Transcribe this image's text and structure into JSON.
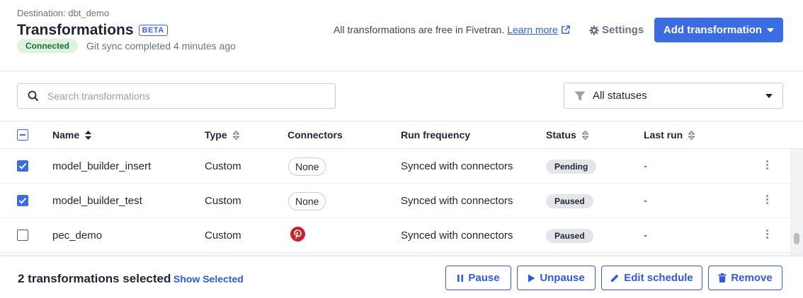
{
  "header": {
    "destination": "Destination: dbt_demo",
    "title": "Transformations",
    "beta": "BETA",
    "connected": "Connected",
    "git_sync": "Git sync completed 4 minutes ago",
    "free_note": "All transformations are free in Fivetran.",
    "learn_more": "Learn more",
    "settings": "Settings",
    "add_button": "Add transformation"
  },
  "filters": {
    "search_placeholder": "Search transformations",
    "status_selected": "All statuses"
  },
  "table": {
    "columns": [
      "Name",
      "Type",
      "Connectors",
      "Run frequency",
      "Status",
      "Last run"
    ],
    "rows": [
      {
        "name": "model_builder_insert",
        "type": "Custom",
        "connector": "None",
        "frequency": "Synced with connectors",
        "status": "Pending",
        "last_run": "-",
        "checked": true
      },
      {
        "name": "model_builder_test",
        "type": "Custom",
        "connector": "None",
        "frequency": "Synced with connectors",
        "status": "Paused",
        "last_run": "-",
        "checked": true
      },
      {
        "name": "pec_demo",
        "type": "Custom",
        "connector": "pinterest-icon",
        "frequency": "Synced with connectors",
        "status": "Paused",
        "last_run": "-",
        "checked": false
      }
    ]
  },
  "bottom_bar": {
    "selected_count": "2 transformations selected",
    "show_selected": "Show Selected",
    "pause": "Pause",
    "unpause": "Unpause",
    "edit_schedule": "Edit schedule",
    "remove": "Remove"
  },
  "colors": {
    "primary": "#3b6de0",
    "link": "#2f5bd9",
    "connected_bg": "#dbf3df",
    "pinterest": "#c8232c"
  }
}
